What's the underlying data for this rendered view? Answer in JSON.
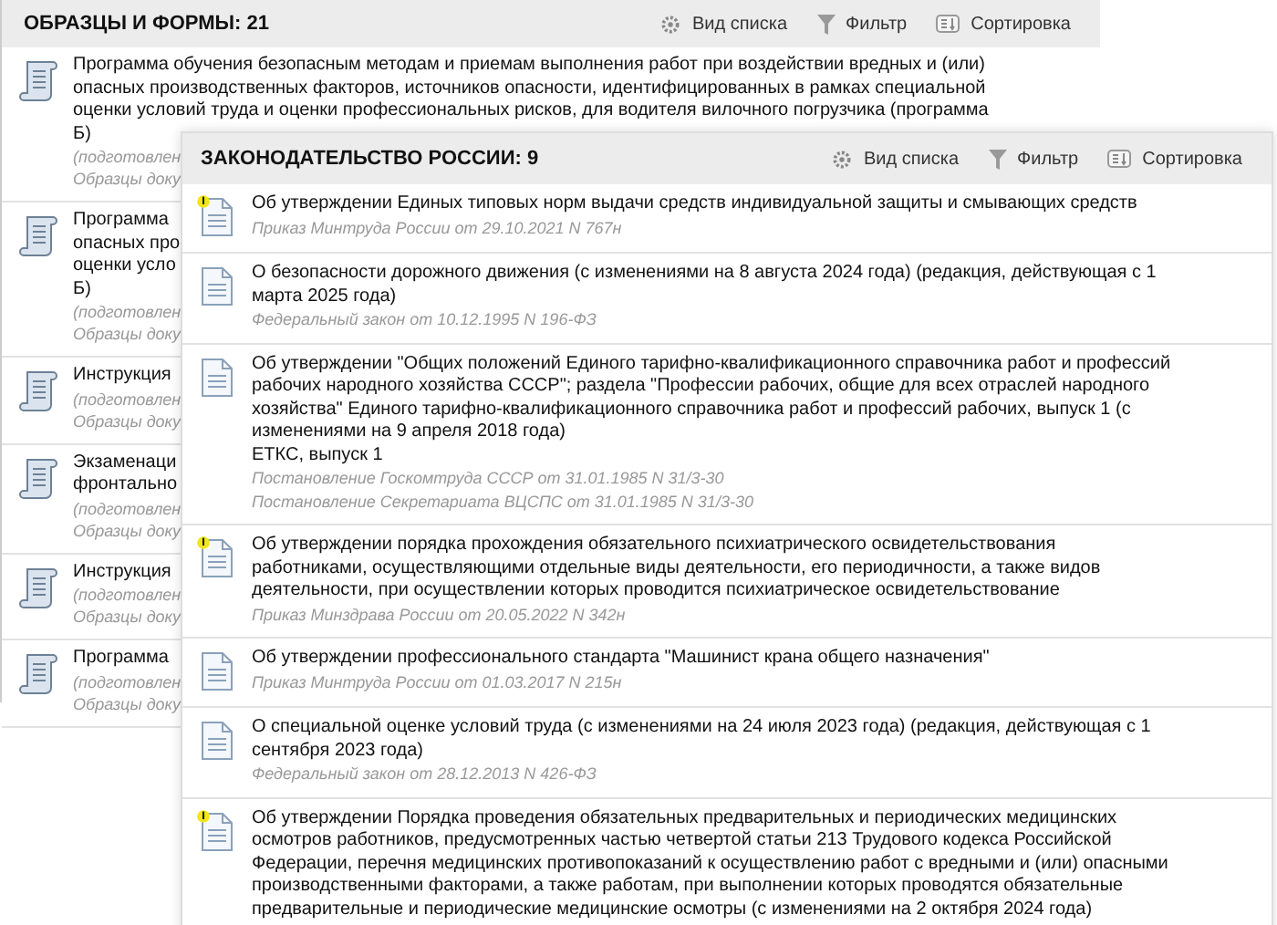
{
  "back_panel": {
    "title": "ОБРАЗЦЫ И ФОРМЫ: 21",
    "toolbar": [
      {
        "kind": "view",
        "label": "Вид списка"
      },
      {
        "kind": "filter",
        "label": "Фильтр"
      },
      {
        "kind": "sort",
        "label": "Сортировка"
      }
    ],
    "items": [
      {
        "title": "Программа обучения безопасным методам и приемам выполнения работ при воздействии вредных и (или) опасных производственных факторов, источников опасности, идентифицированных в рамках специальной оценки условий труда и оценки профессиональных рисков, для водителя вилочного погрузчика (программа Б)",
        "notes": [
          "(подготовлен",
          "Образцы доку"
        ]
      },
      {
        "title": "Программа\nопасных про\nоценки усло\nБ)",
        "notes": [
          "(подготовлен",
          "Образцы доку"
        ]
      },
      {
        "title": "Инструкция",
        "notes": [
          "(подготовлен",
          "Образцы доку"
        ]
      },
      {
        "title": "Экзаменаци\nфронтально",
        "notes": [
          "(подготовлен",
          "Образцы доку"
        ]
      },
      {
        "title": "Инструкция",
        "notes": [
          "(подготовлен",
          "Образцы доку"
        ]
      },
      {
        "title": "Программа",
        "notes": [
          "(подготовлен",
          "Образцы доку"
        ]
      }
    ]
  },
  "front_panel": {
    "title": "ЗАКОНОДАТЕЛЬСТВО РОССИИ: 9",
    "toolbar": [
      {
        "kind": "view",
        "label": "Вид списка"
      },
      {
        "kind": "filter",
        "label": "Фильтр"
      },
      {
        "kind": "sort",
        "label": "Сортировка"
      }
    ],
    "items": [
      {
        "warning": true,
        "title": "Об утверждении Единых типовых норм выдачи средств индивидуальной защиты и смывающих средств",
        "sources": [
          "Приказ Минтруда России от 29.10.2021 N 767н"
        ]
      },
      {
        "warning": false,
        "title": "О безопасности дорожного движения (с изменениями на 8 августа 2024 года) (редакция, действующая с 1 марта 2025 года)",
        "sources": [
          "Федеральный закон от 10.12.1995 N 196-ФЗ"
        ]
      },
      {
        "warning": false,
        "title": "Об утверждении \"Общих положений Единого тарифно-квалификационного справочника работ и профессий рабочих народного хозяйства СССР\"; раздела \"Профессии рабочих, общие для всех отраслей народного хозяйства\" Единого тарифно-квалификационного справочника работ и профессий рабочих, выпуск 1 (с изменениями на 9 апреля 2018 года)",
        "subtitle": "ЕТКС, выпуск 1",
        "sources": [
          "Постановление Госкомтруда СССР от 31.01.1985 N 31/3-30",
          "Постановление Секретариата ВЦСПС от 31.01.1985 N 31/3-30"
        ]
      },
      {
        "warning": true,
        "title": "Об утверждении порядка прохождения обязательного психиатрического освидетельствования работниками, осуществляющими отдельные виды деятельности, его периодичности, а также видов деятельности, при осуществлении которых проводится психиатрическое освидетельствование",
        "sources": [
          "Приказ Минздрава России от 20.05.2022 N 342н"
        ]
      },
      {
        "warning": false,
        "title": "Об утверждении профессионального стандарта \"Машинист крана общего назначения\"",
        "sources": [
          "Приказ Минтруда России от 01.03.2017 N 215н"
        ]
      },
      {
        "warning": false,
        "title": "О специальной оценке условий труда (с изменениями на 24 июля 2023 года) (редакция, действующая с 1 сентября 2023 года)",
        "sources": [
          "Федеральный закон от 28.12.2013 N 426-ФЗ"
        ]
      },
      {
        "warning": true,
        "title": "Об утверждении Порядка проведения обязательных предварительных и периодических медицинских осмотров работников, предусмотренных частью четвертой статьи 213 Трудового кодекса Российской Федерации, перечня медицинских противопоказаний к осуществлению работ с вредными и (или) опасными производственными факторами, а также работам, при выполнении которых проводятся обязательные предварительные и периодические медицинские осмотры (с изменениями на 2 октября 2024 года)"
      }
    ]
  }
}
